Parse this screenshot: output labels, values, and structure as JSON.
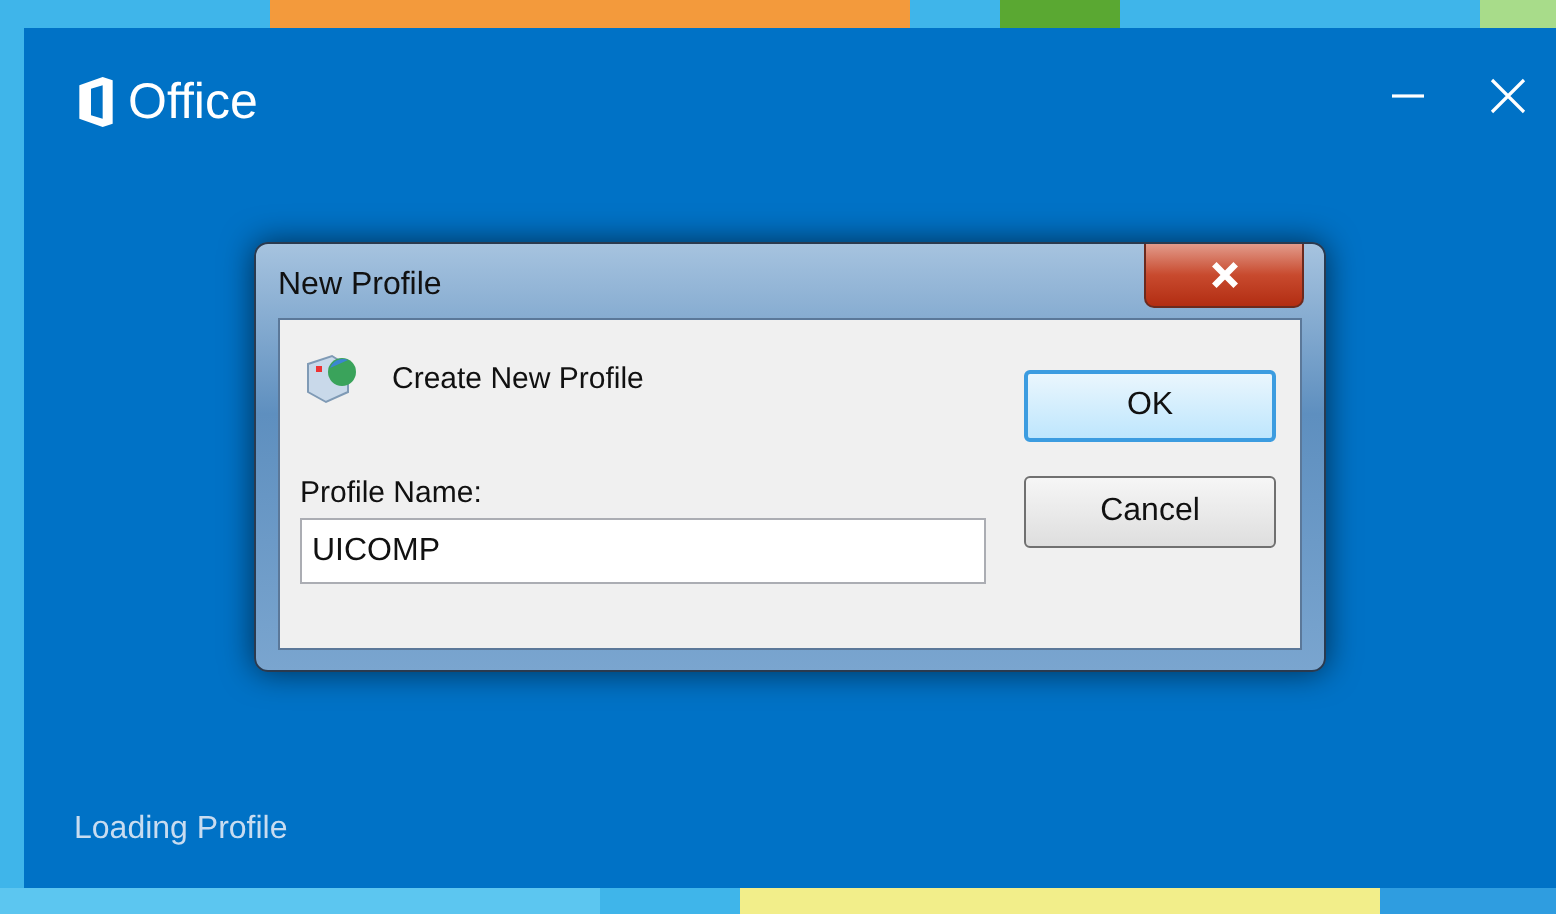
{
  "splash": {
    "logo_text": "Office",
    "status": "Loading Profile"
  },
  "dialog": {
    "title": "New Profile",
    "heading": "Create New Profile",
    "field": {
      "label": "Profile Name:",
      "value": "UICOMP"
    },
    "buttons": [
      {
        "label": "OK",
        "default": true
      },
      {
        "label": "Cancel",
        "default": false
      }
    ]
  }
}
